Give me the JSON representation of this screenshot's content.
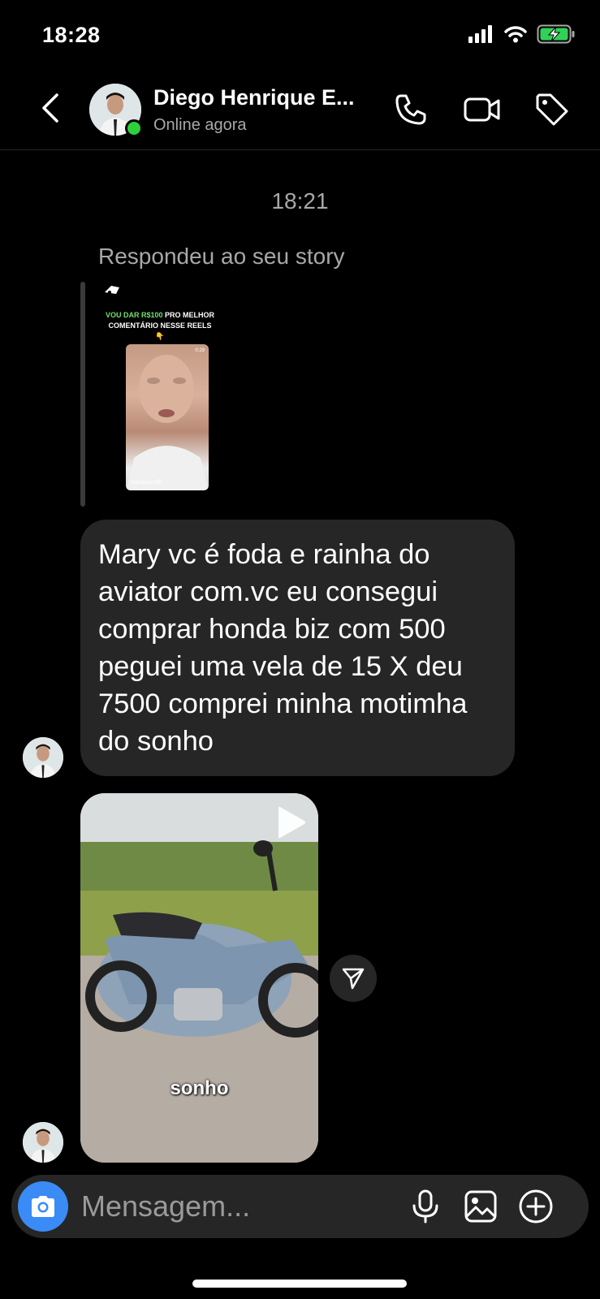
{
  "status_bar": {
    "time": "18:28",
    "icons": [
      "signal-icon",
      "wifi-icon",
      "battery-charging-icon"
    ]
  },
  "header": {
    "contact_name": "Diego Henrique E...",
    "contact_status": "Online agora",
    "icons": [
      "back-icon",
      "phone-icon",
      "video-call-icon",
      "tag-icon"
    ]
  },
  "conversation": {
    "timestamp": "18:21",
    "reply_note": "Respondeu ao seu story",
    "story": {
      "text_highlight": "VOU DAR R$100",
      "text_rest": "PRO MELHOR COMENTÁRIO NESSE REELS 👇",
      "username": "mariaciorafft",
      "duration": "0:29"
    },
    "message_text": "Mary vc é foda e rainha do aviator com.vc eu consegui comprar honda biz com 500 peguei uma  vela de  15 X deu 7500  comprei minha motimha do sonho",
    "video": {
      "caption": "sonho"
    }
  },
  "composer": {
    "placeholder": "Mensagem...",
    "icons": [
      "camera-icon",
      "microphone-icon",
      "gallery-icon",
      "add-icon"
    ]
  },
  "colors": {
    "background": "#000000",
    "bubble": "#262626",
    "secondary_text": "#a8a8a8",
    "online": "#2dcf3b",
    "camera_button": "#3a8bf5"
  }
}
